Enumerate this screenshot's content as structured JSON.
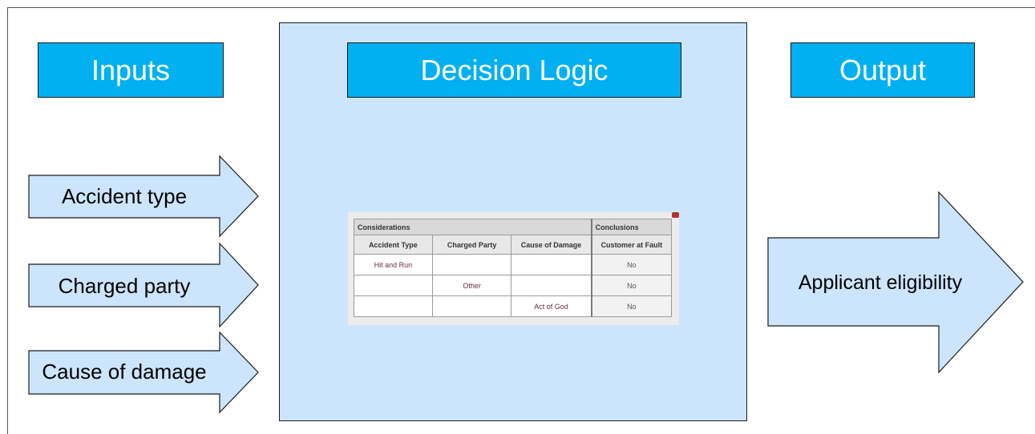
{
  "headers": {
    "inputs": "Inputs",
    "logic": "Decision Logic",
    "output": "Output"
  },
  "inputs": [
    {
      "label": "Accident type"
    },
    {
      "label": "Charged party"
    },
    {
      "label": "Cause of damage"
    }
  ],
  "output": {
    "label": "Applicant eligibility"
  },
  "decision_table": {
    "group_considerations": "Considerations",
    "group_conclusions": "Conclusions",
    "columns": [
      "Accident Type",
      "Charged Party",
      "Cause of Damage",
      "Customer at Fault"
    ],
    "rows": [
      [
        "Hit and Run",
        "",
        "",
        "No"
      ],
      [
        "",
        "Other",
        "",
        "No"
      ],
      [
        "",
        "",
        "Act of God",
        "No"
      ]
    ]
  },
  "colors": {
    "header_fill": "#00b0f0",
    "arrow_fill": "#cce5fc",
    "panel_fill": "#cce5fc"
  }
}
